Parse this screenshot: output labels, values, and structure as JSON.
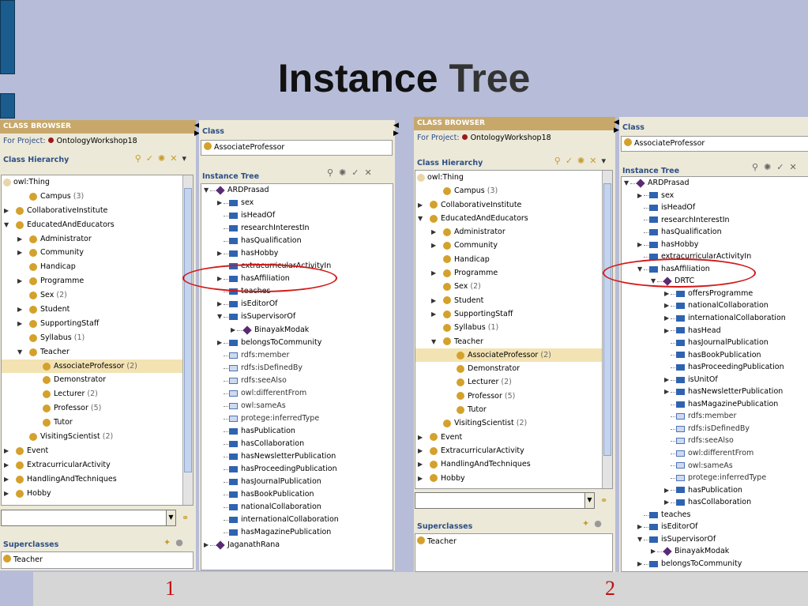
{
  "slide": {
    "title_a": "Instance",
    "title_b": "Tree",
    "num1": "1",
    "num2": "2"
  },
  "p1": {
    "header": "CLASS BROWSER",
    "project_label": "For Project:",
    "project": "OntologyWorkshop18",
    "hier": "Class Hierarchy",
    "rows": [
      {
        "label": "owl:Thing",
        "count": "",
        "depth": 0,
        "arrow": "",
        "top": true
      },
      {
        "label": "Campus",
        "count": "(3)",
        "depth": 1,
        "arrow": ""
      },
      {
        "label": "CollaborativeInstitute",
        "count": "",
        "depth": 0,
        "arrow": "▶"
      },
      {
        "label": "EducatedAndEducators",
        "count": "",
        "depth": 0,
        "arrow": "▼"
      },
      {
        "label": "Administrator",
        "count": "",
        "depth": 1,
        "arrow": "▶"
      },
      {
        "label": "Community",
        "count": "",
        "depth": 1,
        "arrow": "▶"
      },
      {
        "label": "Handicap",
        "count": "",
        "depth": 1,
        "arrow": ""
      },
      {
        "label": "Programme",
        "count": "",
        "depth": 1,
        "arrow": "▶"
      },
      {
        "label": "Sex",
        "count": "(2)",
        "depth": 1,
        "arrow": ""
      },
      {
        "label": "Student",
        "count": "",
        "depth": 1,
        "arrow": "▶"
      },
      {
        "label": "SupportingStaff",
        "count": "",
        "depth": 1,
        "arrow": "▶"
      },
      {
        "label": "Syllabus",
        "count": "(1)",
        "depth": 1,
        "arrow": ""
      },
      {
        "label": "Teacher",
        "count": "",
        "depth": 1,
        "arrow": "▼"
      },
      {
        "label": "AssociateProfessor",
        "count": "(2)",
        "depth": 2,
        "arrow": "",
        "sel": true
      },
      {
        "label": "Demonstrator",
        "count": "",
        "depth": 2,
        "arrow": ""
      },
      {
        "label": "Lecturer",
        "count": "(2)",
        "depth": 2,
        "arrow": ""
      },
      {
        "label": "Professor",
        "count": "(5)",
        "depth": 2,
        "arrow": ""
      },
      {
        "label": "Tutor",
        "count": "",
        "depth": 2,
        "arrow": ""
      },
      {
        "label": "VisitingScientist",
        "count": "(2)",
        "depth": 1,
        "arrow": ""
      },
      {
        "label": "Event",
        "count": "",
        "depth": 0,
        "arrow": "▶"
      },
      {
        "label": "ExtracurricularActivity",
        "count": "",
        "depth": 0,
        "arrow": "▶"
      },
      {
        "label": "HandlingAndTechniques",
        "count": "",
        "depth": 0,
        "arrow": "▶"
      },
      {
        "label": "Hobby",
        "count": "",
        "depth": 0,
        "arrow": "▶"
      }
    ],
    "superclasses": "Superclasses",
    "super_item": "Teacher",
    "class_label": "Class",
    "class_value": "AssociateProfessor",
    "instance_tree": "Instance Tree",
    "tree": [
      {
        "label": "ARDPrasad",
        "lvl": 0,
        "icon": "dia",
        "arrow": "▼"
      },
      {
        "label": "sex",
        "lvl": 1,
        "icon": "sq",
        "arrow": "▶"
      },
      {
        "label": "isHeadOf",
        "lvl": 1,
        "icon": "sq",
        "arrow": ""
      },
      {
        "label": "researchInterestIn",
        "lvl": 1,
        "icon": "sq",
        "arrow": ""
      },
      {
        "label": "hasQualification",
        "lvl": 1,
        "icon": "sq",
        "arrow": ""
      },
      {
        "label": "hasHobby",
        "lvl": 1,
        "icon": "sq",
        "arrow": "▶"
      },
      {
        "label": "extracurricularActivityIn",
        "lvl": 1,
        "icon": "sq",
        "arrow": ""
      },
      {
        "label": "hasAffiliation",
        "lvl": 1,
        "icon": "sq",
        "arrow": "▶"
      },
      {
        "label": "teaches",
        "lvl": 1,
        "icon": "sq",
        "arrow": ""
      },
      {
        "label": "isEditorOf",
        "lvl": 1,
        "icon": "sq",
        "arrow": "▶"
      },
      {
        "label": "isSupervisorOf",
        "lvl": 1,
        "icon": "sq",
        "arrow": "▼"
      },
      {
        "label": "BinayakModak",
        "lvl": 2,
        "icon": "dia",
        "arrow": "▶"
      },
      {
        "label": "belongsToCommunity",
        "lvl": 1,
        "icon": "sq",
        "arrow": "▶"
      },
      {
        "label": "rdfs:member",
        "lvl": 1,
        "icon": "sql",
        "arrow": ""
      },
      {
        "label": "rdfs:isDefinedBy",
        "lvl": 1,
        "icon": "sql",
        "arrow": ""
      },
      {
        "label": "rdfs:seeAlso",
        "lvl": 1,
        "icon": "sql",
        "arrow": ""
      },
      {
        "label": "owl:differentFrom",
        "lvl": 1,
        "icon": "sql",
        "arrow": ""
      },
      {
        "label": "owl:sameAs",
        "lvl": 1,
        "icon": "sql",
        "arrow": ""
      },
      {
        "label": "protege:inferredType",
        "lvl": 1,
        "icon": "sql",
        "arrow": ""
      },
      {
        "label": "hasPublication",
        "lvl": 1,
        "icon": "sq",
        "arrow": ""
      },
      {
        "label": "hasCollaboration",
        "lvl": 1,
        "icon": "sq",
        "arrow": ""
      },
      {
        "label": "hasNewsletterPublication",
        "lvl": 1,
        "icon": "sq",
        "arrow": ""
      },
      {
        "label": "hasProceedingPublication",
        "lvl": 1,
        "icon": "sq",
        "arrow": ""
      },
      {
        "label": "hasJournalPublication",
        "lvl": 1,
        "icon": "sq",
        "arrow": ""
      },
      {
        "label": "hasBookPublication",
        "lvl": 1,
        "icon": "sq",
        "arrow": ""
      },
      {
        "label": "nationalCollaboration",
        "lvl": 1,
        "icon": "sq",
        "arrow": ""
      },
      {
        "label": "internationalCollaboration",
        "lvl": 1,
        "icon": "sq",
        "arrow": ""
      },
      {
        "label": "hasMagazinePublication",
        "lvl": 1,
        "icon": "sq",
        "arrow": ""
      },
      {
        "label": "JaganathRana",
        "lvl": 0,
        "icon": "dia",
        "arrow": "▶"
      }
    ]
  },
  "p2": {
    "header": "CLASS BROWSER",
    "project_label": "For Project:",
    "project": "OntologyWorkshop18",
    "hier": "Class Hierarchy",
    "rows": [
      {
        "label": "owl:Thing",
        "count": "",
        "depth": 0,
        "arrow": "",
        "top": true
      },
      {
        "label": "Campus",
        "count": "(3)",
        "depth": 1,
        "arrow": ""
      },
      {
        "label": "CollaborativeInstitute",
        "count": "",
        "depth": 0,
        "arrow": "▶"
      },
      {
        "label": "EducatedAndEducators",
        "count": "",
        "depth": 0,
        "arrow": "▼"
      },
      {
        "label": "Administrator",
        "count": "",
        "depth": 1,
        "arrow": "▶"
      },
      {
        "label": "Community",
        "count": "",
        "depth": 1,
        "arrow": "▶"
      },
      {
        "label": "Handicap",
        "count": "",
        "depth": 1,
        "arrow": ""
      },
      {
        "label": "Programme",
        "count": "",
        "depth": 1,
        "arrow": "▶"
      },
      {
        "label": "Sex",
        "count": "(2)",
        "depth": 1,
        "arrow": ""
      },
      {
        "label": "Student",
        "count": "",
        "depth": 1,
        "arrow": "▶"
      },
      {
        "label": "SupportingStaff",
        "count": "",
        "depth": 1,
        "arrow": "▶"
      },
      {
        "label": "Syllabus",
        "count": "(1)",
        "depth": 1,
        "arrow": ""
      },
      {
        "label": "Teacher",
        "count": "",
        "depth": 1,
        "arrow": "▼"
      },
      {
        "label": "AssociateProfessor",
        "count": "(2)",
        "depth": 2,
        "arrow": "",
        "sel": true
      },
      {
        "label": "Demonstrator",
        "count": "",
        "depth": 2,
        "arrow": ""
      },
      {
        "label": "Lecturer",
        "count": "(2)",
        "depth": 2,
        "arrow": ""
      },
      {
        "label": "Professor",
        "count": "(5)",
        "depth": 2,
        "arrow": ""
      },
      {
        "label": "Tutor",
        "count": "",
        "depth": 2,
        "arrow": ""
      },
      {
        "label": "VisitingScientist",
        "count": "(2)",
        "depth": 1,
        "arrow": ""
      },
      {
        "label": "Event",
        "count": "",
        "depth": 0,
        "arrow": "▶"
      },
      {
        "label": "ExtracurricularActivity",
        "count": "",
        "depth": 0,
        "arrow": "▶"
      },
      {
        "label": "HandlingAndTechniques",
        "count": "",
        "depth": 0,
        "arrow": "▶"
      },
      {
        "label": "Hobby",
        "count": "",
        "depth": 0,
        "arrow": "▶"
      }
    ],
    "superclasses": "Superclasses",
    "super_item": "Teacher",
    "class_label": "Class",
    "class_value": "AssociateProfessor",
    "instance_tree": "Instance Tree",
    "tree": [
      {
        "label": "ARDPrasad",
        "lvl": 0,
        "icon": "dia",
        "arrow": "▼"
      },
      {
        "label": "sex",
        "lvl": 1,
        "icon": "sq",
        "arrow": "▶"
      },
      {
        "label": "isHeadOf",
        "lvl": 1,
        "icon": "sq",
        "arrow": ""
      },
      {
        "label": "researchInterestIn",
        "lvl": 1,
        "icon": "sq",
        "arrow": ""
      },
      {
        "label": "hasQualification",
        "lvl": 1,
        "icon": "sq",
        "arrow": ""
      },
      {
        "label": "hasHobby",
        "lvl": 1,
        "icon": "sq",
        "arrow": "▶"
      },
      {
        "label": "extracurricularActivityIn",
        "lvl": 1,
        "icon": "sq",
        "arrow": ""
      },
      {
        "label": "hasAffiliation",
        "lvl": 1,
        "icon": "sq",
        "arrow": "▼"
      },
      {
        "label": "DRTC",
        "lvl": 2,
        "icon": "dia",
        "arrow": "▼"
      },
      {
        "label": "offersProgramme",
        "lvl": 3,
        "icon": "sq",
        "arrow": "▶"
      },
      {
        "label": "nationalCollaboration",
        "lvl": 3,
        "icon": "sq",
        "arrow": "▶"
      },
      {
        "label": "internationalCollaboration",
        "lvl": 3,
        "icon": "sq",
        "arrow": "▶"
      },
      {
        "label": "hasHead",
        "lvl": 3,
        "icon": "sq",
        "arrow": "▶"
      },
      {
        "label": "hasJournalPublication",
        "lvl": 3,
        "icon": "sq",
        "arrow": ""
      },
      {
        "label": "hasBookPublication",
        "lvl": 3,
        "icon": "sq",
        "arrow": ""
      },
      {
        "label": "hasProceedingPublication",
        "lvl": 3,
        "icon": "sq",
        "arrow": ""
      },
      {
        "label": "isUnitOf",
        "lvl": 3,
        "icon": "sq",
        "arrow": "▶"
      },
      {
        "label": "hasNewsletterPublication",
        "lvl": 3,
        "icon": "sq",
        "arrow": "▶"
      },
      {
        "label": "hasMagazinePublication",
        "lvl": 3,
        "icon": "sq",
        "arrow": ""
      },
      {
        "label": "rdfs:member",
        "lvl": 3,
        "icon": "sql",
        "arrow": ""
      },
      {
        "label": "rdfs:isDefinedBy",
        "lvl": 3,
        "icon": "sql",
        "arrow": ""
      },
      {
        "label": "rdfs:seeAlso",
        "lvl": 3,
        "icon": "sql",
        "arrow": ""
      },
      {
        "label": "owl:differentFrom",
        "lvl": 3,
        "icon": "sql",
        "arrow": ""
      },
      {
        "label": "owl:sameAs",
        "lvl": 3,
        "icon": "sql",
        "arrow": ""
      },
      {
        "label": "protege:inferredType",
        "lvl": 3,
        "icon": "sql",
        "arrow": ""
      },
      {
        "label": "hasPublication",
        "lvl": 3,
        "icon": "sq",
        "arrow": "▶"
      },
      {
        "label": "hasCollaboration",
        "lvl": 3,
        "icon": "sq",
        "arrow": "▶"
      },
      {
        "label": "teaches",
        "lvl": 1,
        "icon": "sq",
        "arrow": ""
      },
      {
        "label": "isEditorOf",
        "lvl": 1,
        "icon": "sq",
        "arrow": "▶"
      },
      {
        "label": "isSupervisorOf",
        "lvl": 1,
        "icon": "sq",
        "arrow": "▼"
      },
      {
        "label": "BinayakModak",
        "lvl": 2,
        "icon": "dia",
        "arrow": "▶"
      },
      {
        "label": "belongsToCommunity",
        "lvl": 1,
        "icon": "sq",
        "arrow": "▶"
      }
    ]
  }
}
